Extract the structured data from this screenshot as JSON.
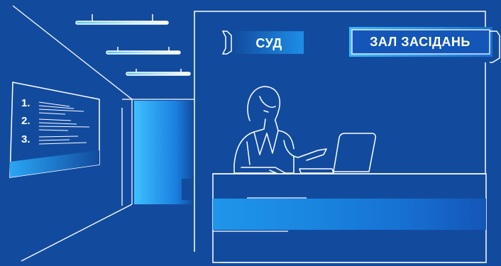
{
  "signs": {
    "court": "СУД",
    "hearing_room": "ЗАЛ ЗАСІДАНЬ"
  },
  "board": {
    "items": [
      "1.",
      "2.",
      "3."
    ]
  },
  "colors": {
    "background": "#124b9e",
    "line": "#ffffff",
    "accent_light": "#3fb6ff",
    "accent_mid": "#1a8fe8",
    "accent_dark": "#1253b3"
  }
}
